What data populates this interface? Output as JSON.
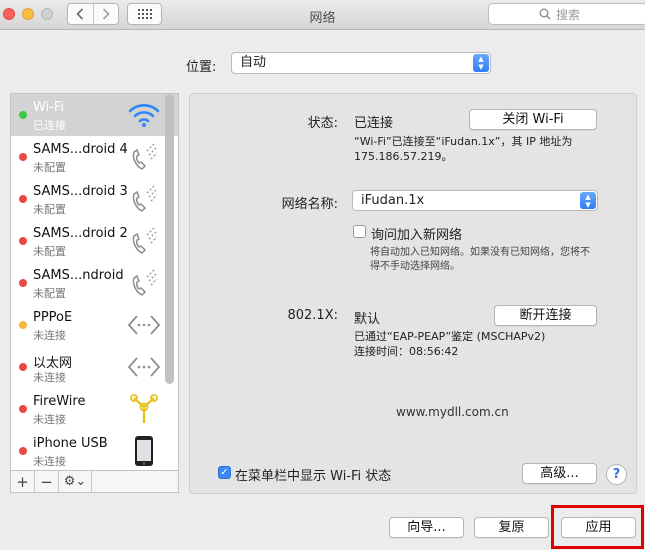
{
  "window": {
    "title": "网络",
    "search_placeholder": "搜索"
  },
  "location": {
    "label": "位置:",
    "value": "自动"
  },
  "services": [
    {
      "name": "Wi-Fi",
      "status": "已连接",
      "status_color": "green",
      "icon": "wifi-icon",
      "selected": true
    },
    {
      "name": "SAMS...droid 4",
      "status": "未配置",
      "status_color": "red",
      "icon": "phone-icon"
    },
    {
      "name": "SAMS...droid 3",
      "status": "未配置",
      "status_color": "red",
      "icon": "phone-icon"
    },
    {
      "name": "SAMS...droid 2",
      "status": "未配置",
      "status_color": "red",
      "icon": "phone-icon"
    },
    {
      "name": "SAMS...ndroid",
      "status": "未配置",
      "status_color": "red",
      "icon": "phone-icon"
    },
    {
      "name": "PPPoE",
      "status": "未连接",
      "status_color": "yellow",
      "icon": "ethernet-arrows-icon"
    },
    {
      "name": "以太网",
      "status": "未连接",
      "status_color": "red",
      "icon": "ethernet-arrows-icon"
    },
    {
      "name": "FireWire",
      "status": "未连接",
      "status_color": "red",
      "icon": "firewire-icon"
    },
    {
      "name": "iPhone USB",
      "status": "未连接",
      "status_color": "red",
      "icon": "iphone-icon"
    }
  ],
  "sidebar_footer": {
    "add": "+",
    "remove": "−",
    "gear": "⚙︎⌄"
  },
  "detail": {
    "status_label": "状态:",
    "status_value": "已连接",
    "wifi_off_button": "关闭 Wi-Fi",
    "status_desc_line1": "“Wi-Fi”已连接至“iFudan.1x”，其 IP 地址为",
    "status_desc_line2": "175.186.57.219。",
    "network_name_label": "网络名称:",
    "network_name_value": "iFudan.1x",
    "ask_join_label": "询问加入新网络",
    "ask_join_desc_line1": "将自动加入已知网络。如果没有已知网络，您将不",
    "ask_join_desc_line2": "得不手动选择网络。",
    "dot1x_label": "802.1X:",
    "dot1x_value": "默认",
    "disconnect_button": "断开连接",
    "dot1x_desc_line1": "已通过“EAP-PEAP”鉴定 (MSCHAPv2)",
    "dot1x_desc_line2": "连接时间：08:56:42",
    "watermark": "www.mydll.com.cn",
    "show_menubar_label": "在菜单栏中显示 Wi-Fi 状态",
    "advanced_button": "高级...",
    "help_button": "?"
  },
  "bottom_buttons": {
    "assist": "向导...",
    "revert": "复原",
    "apply": "应用"
  },
  "colors": {
    "accent": "#3b87f7",
    "highlight": "#e00000"
  }
}
